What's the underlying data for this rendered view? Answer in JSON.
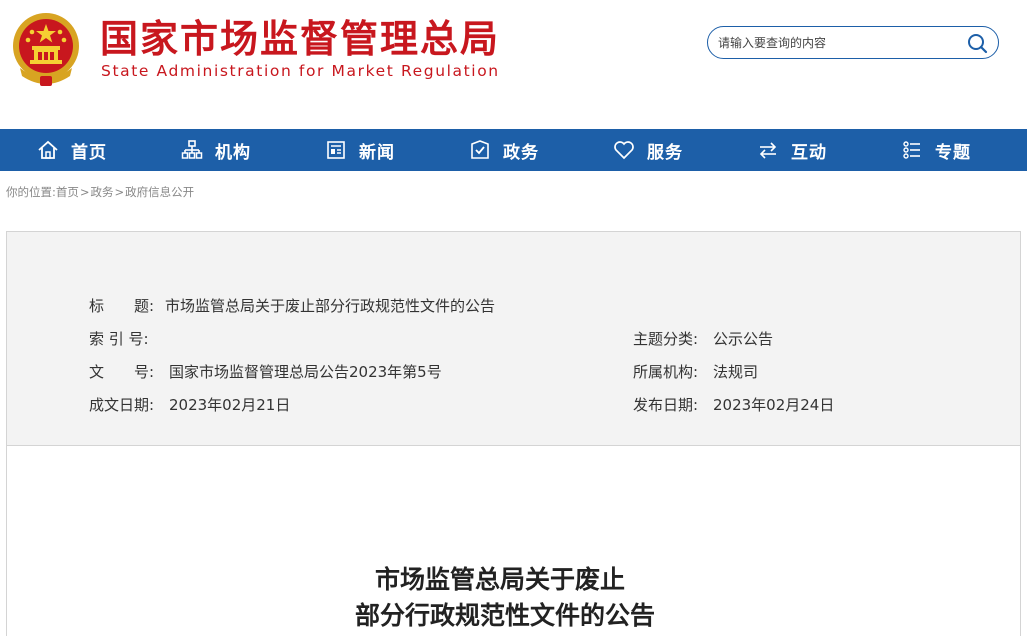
{
  "header": {
    "site_name_cn": "国家市场监督管理总局",
    "site_name_en": "State Administration for Market Regulation",
    "emblem_icon": "national-emblem-icon"
  },
  "search": {
    "placeholder": "请输入要查询的内容",
    "icon": "search-icon"
  },
  "nav": {
    "items": [
      {
        "label": "首页",
        "icon": "home-icon"
      },
      {
        "label": "机构",
        "icon": "org-chart-icon"
      },
      {
        "label": "新闻",
        "icon": "newspaper-icon"
      },
      {
        "label": "政务",
        "icon": "government-affairs-icon"
      },
      {
        "label": "服务",
        "icon": "heart-icon"
      },
      {
        "label": "互动",
        "icon": "exchange-arrows-icon"
      },
      {
        "label": "专题",
        "icon": "topics-list-icon"
      }
    ]
  },
  "breadcrumb": {
    "prefix": "你的位置:",
    "items": [
      "首页",
      "政务",
      "政府信息公开"
    ],
    "separator": ">"
  },
  "info": {
    "title_label": "标　　题:",
    "title_value": "市场监管总局关于废止部分行政规范性文件的公告",
    "index_label": "索 引 号:",
    "index_value": "",
    "category_label": "主题分类:",
    "category_value": "公示公告",
    "docno_label": "文　　号:",
    "docno_value": "国家市场监督管理总局公告2023年第5号",
    "org_label": "所属机构:",
    "org_value": "法规司",
    "created_label": "成文日期:",
    "created_value": "2023年02月21日",
    "published_label": "发布日期:",
    "published_value": "2023年02月24日"
  },
  "document": {
    "title_line1": "市场监管总局关于废止",
    "title_line2": "部分行政规范性文件的公告"
  },
  "colors": {
    "brand_red": "#c8171e",
    "nav_blue": "#1d5fa8",
    "info_bg": "#f3f3f3"
  }
}
